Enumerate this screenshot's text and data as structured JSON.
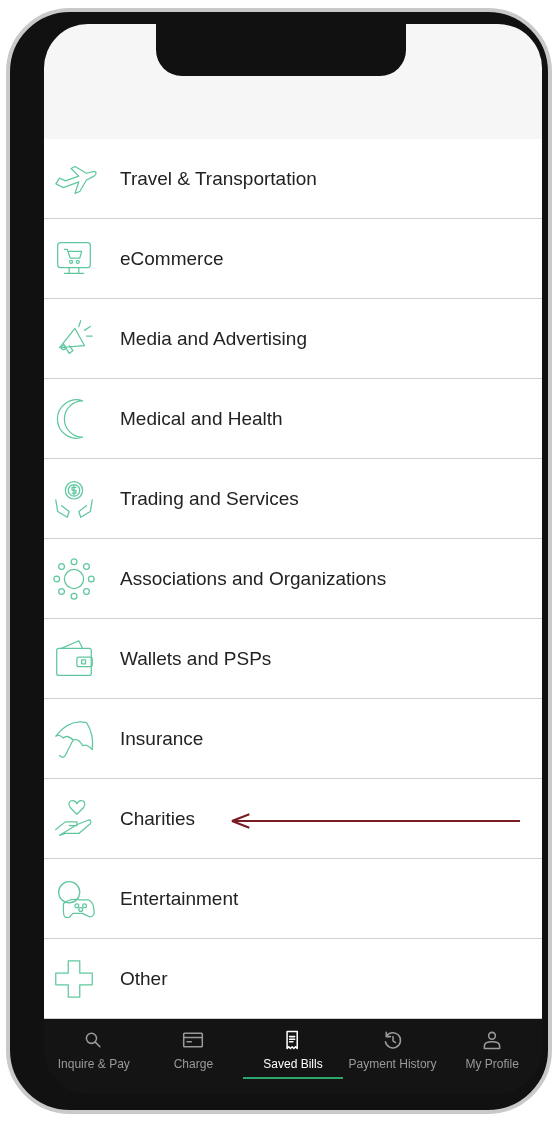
{
  "categories": [
    {
      "label": "Travel & Transportation",
      "marked": false
    },
    {
      "label": "eCommerce",
      "marked": false
    },
    {
      "label": "Media and Advertising",
      "marked": false
    },
    {
      "label": "Medical and Health",
      "marked": false
    },
    {
      "label": "Trading and Services",
      "marked": false
    },
    {
      "label": "Associations and Organizations",
      "marked": false
    },
    {
      "label": "Wallets and PSPs",
      "marked": false
    },
    {
      "label": "Insurance",
      "marked": false
    },
    {
      "label": "Charities",
      "marked": true
    },
    {
      "label": "Entertainment",
      "marked": false
    },
    {
      "label": "Other",
      "marked": false
    }
  ],
  "tab_bar": [
    {
      "label": "Inquire & Pay",
      "selected": false
    },
    {
      "label": "Charge",
      "selected": false
    },
    {
      "label": "Saved Bills",
      "selected": true
    },
    {
      "label": "Payment History",
      "selected": false
    },
    {
      "label": "My Profile",
      "selected": false
    }
  ]
}
